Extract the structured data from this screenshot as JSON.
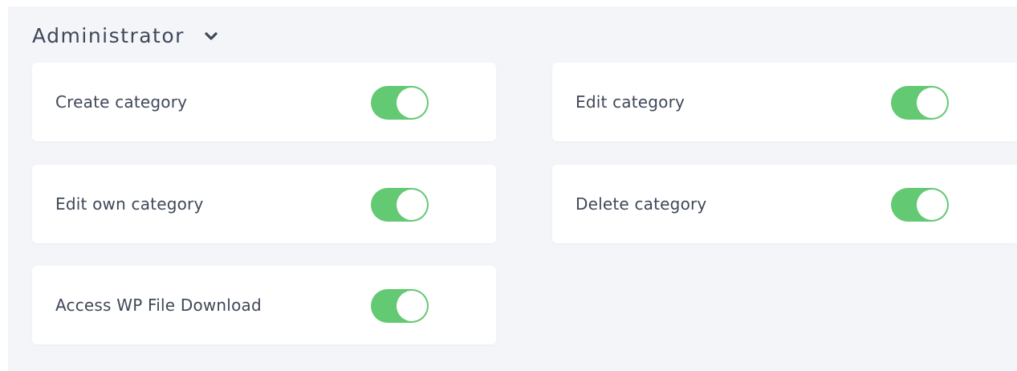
{
  "section": {
    "title": "Administrator",
    "chevron_icon": "chevron-down-icon",
    "expanded": true
  },
  "colors": {
    "toggle_on": "#64c973",
    "panel_background": "#f3f5f9",
    "card_background": "#ffffff",
    "text": "#3f4858"
  },
  "permissions": [
    {
      "label": "Create category",
      "enabled": true
    },
    {
      "label": "Edit category",
      "enabled": true
    },
    {
      "label": "Edit own category",
      "enabled": true
    },
    {
      "label": "Delete category",
      "enabled": true
    },
    {
      "label": "Access WP File Download",
      "enabled": true
    }
  ]
}
